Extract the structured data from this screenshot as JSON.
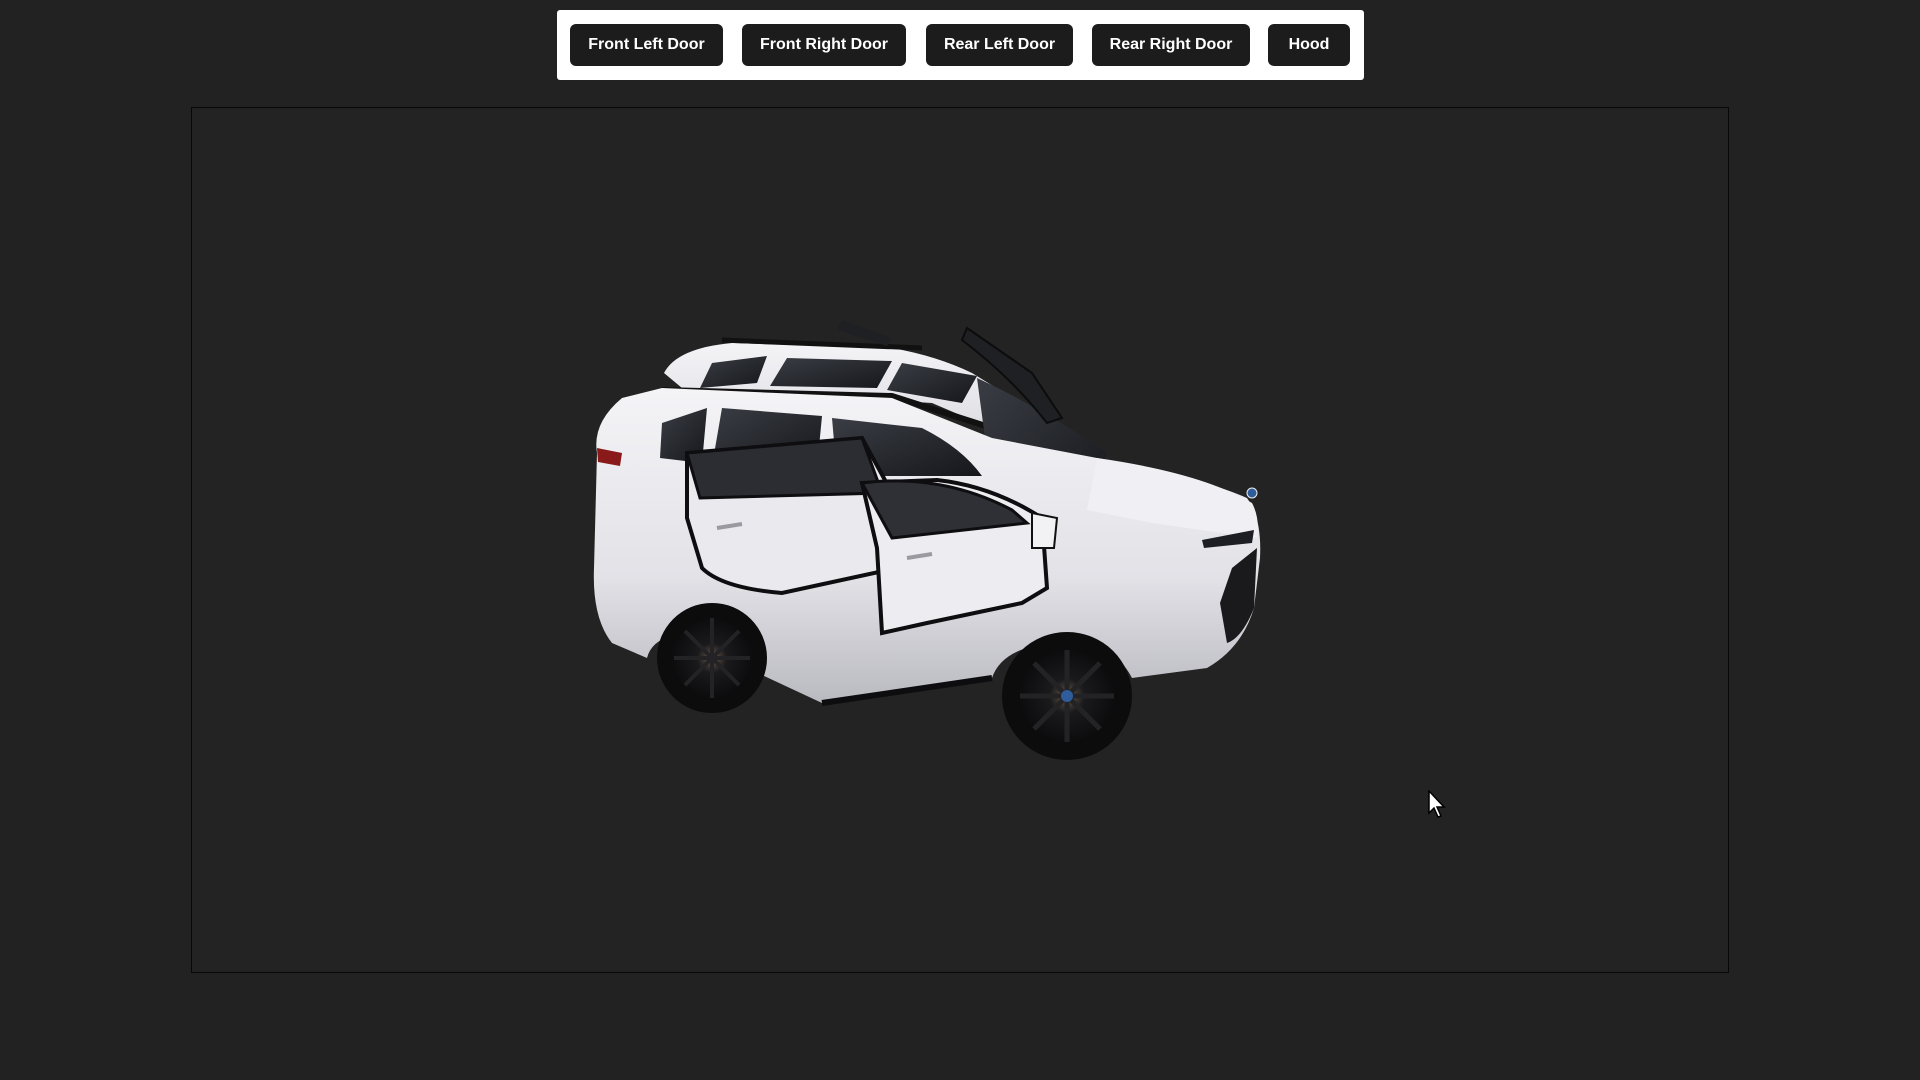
{
  "toolbar": {
    "buttons": [
      {
        "label": "Front Left Door"
      },
      {
        "label": "Front Right Door"
      },
      {
        "label": "Rear Left Door"
      },
      {
        "label": "Rear Right Door"
      },
      {
        "label": "Hood"
      }
    ]
  },
  "colors": {
    "page_background": "#222222",
    "toolbar_background": "#ffffff",
    "button_background": "#1c1c1c",
    "button_text": "#ffffff",
    "car_body": "#e8e8ec"
  },
  "icons": {
    "cursor": "mouse-pointer-icon"
  }
}
